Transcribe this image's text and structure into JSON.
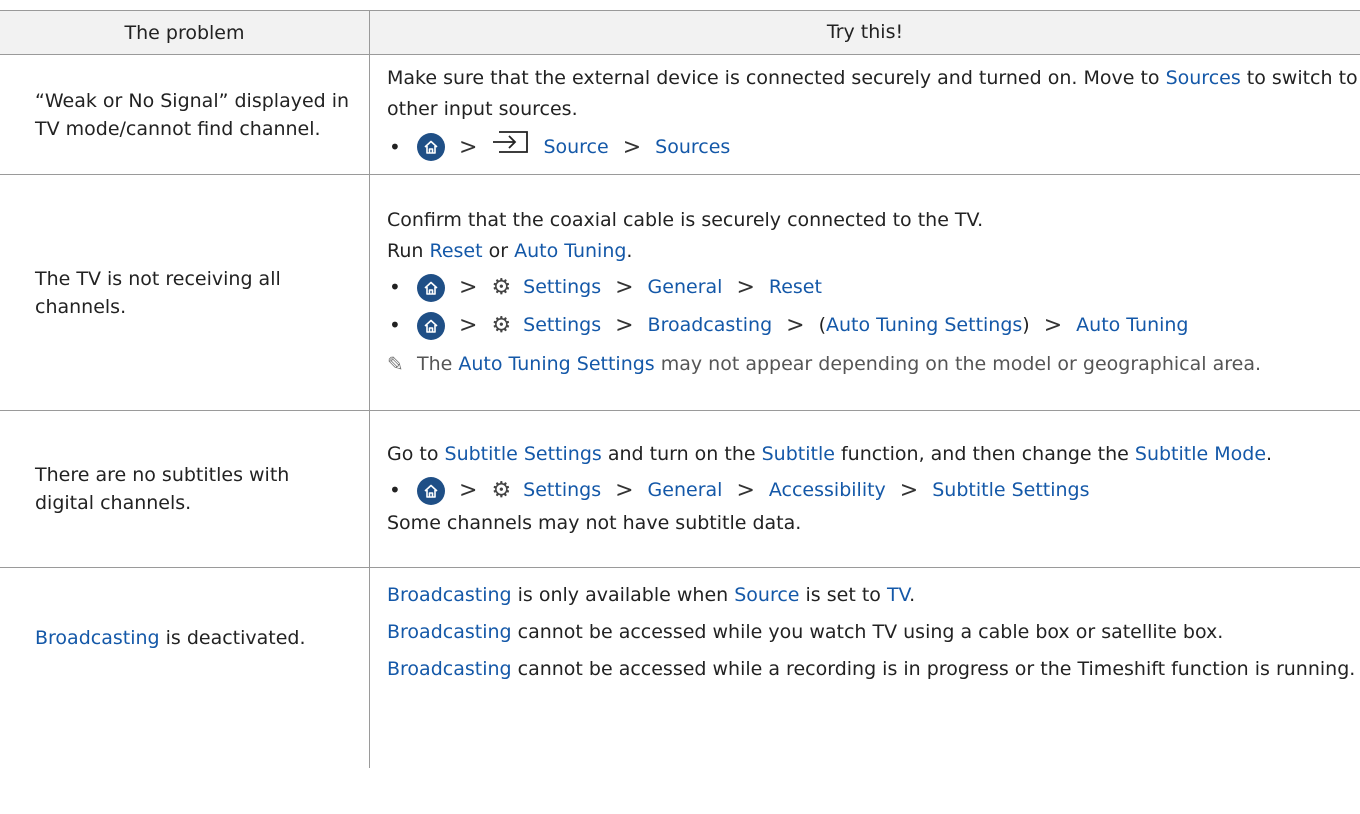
{
  "header": {
    "col_problem": "The problem",
    "col_try": "Try this!"
  },
  "row1": {
    "problem": "“Weak or No Signal” displayed in TV mode/cannot find channel.",
    "text_a": "Make sure that the external device is connected securely and turned on. Move to ",
    "link_sources": "Sources",
    "text_b": " to switch to other input sources.",
    "path": [
      "Source",
      "Sources"
    ]
  },
  "row2": {
    "problem": "The TV is not receiving all channels.",
    "line1": "Confirm that the coaxial cable is securely connected to the TV.",
    "run": "Run ",
    "reset": "Reset",
    "or": " or ",
    "auto_tuning": "Auto Tuning",
    "period": ".",
    "path1": [
      "Settings",
      "General",
      "Reset"
    ],
    "path2_settings": "Settings",
    "path2_broadcasting": "Broadcasting",
    "path2_paren_open": "(",
    "path2_ats": "Auto Tuning Settings",
    "path2_paren_close": ")",
    "path2_last": "Auto Tuning",
    "note_a": "The ",
    "note_link": "Auto Tuning Settings",
    "note_b": " may not appear depending on the model or geographical area."
  },
  "row3": {
    "problem": "There are no subtitles with digital channels.",
    "go_to": "Go to ",
    "subtitle_settings": "Subtitle Settings",
    "turn_on": " and turn on the ",
    "subtitle": "Subtitle",
    "then": " function, and then change the ",
    "subtitle_mode": "Subtitle Mode",
    "period": ".",
    "path": [
      "Settings",
      "General",
      "Accessibility",
      "Subtitle Settings"
    ],
    "last": "Some channels may not have subtitle data."
  },
  "row4": {
    "problem_link": "Broadcasting",
    "problem_rest": " is deactivated.",
    "l1_link1": "Broadcasting",
    "l1_a": " is only available when ",
    "l1_link2": "Source",
    "l1_b": " is set to ",
    "l1_link3": "TV",
    "l1_c": ".",
    "l2_link": "Broadcasting",
    "l2_rest": " cannot be accessed while you watch TV using a cable box or satellite box.",
    "l3_link": "Broadcasting",
    "l3_rest": " cannot be accessed while a recording is in progress or the Timeshift function is running."
  },
  "icons": {
    "home": "home-icon",
    "settings": "gear-icon",
    "source": "source-input-icon",
    "chevron": "chevron-right-icon",
    "note": "pencil-note-icon"
  },
  "colors": {
    "link": "#1458a8",
    "home_circle": "#1f4f86",
    "header_bg": "#f2f2f2"
  }
}
